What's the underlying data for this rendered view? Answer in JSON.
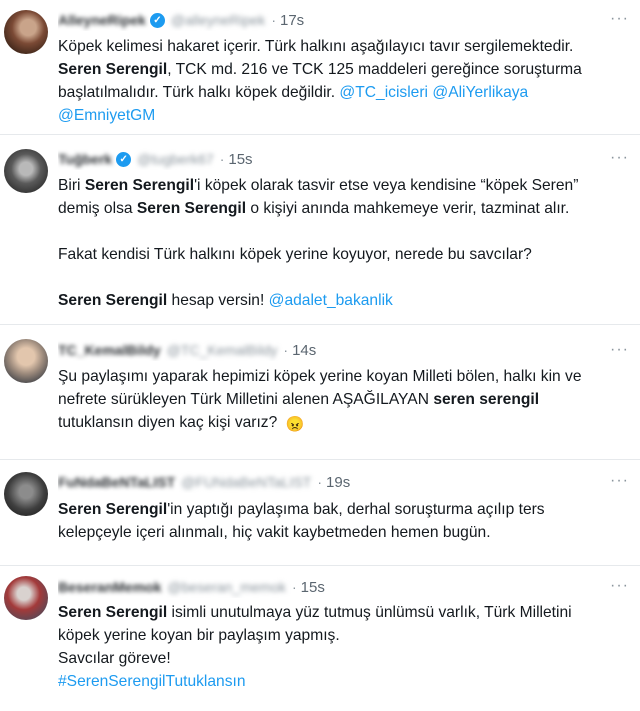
{
  "tweets": [
    {
      "name": "AlleyneRipek",
      "handle": "@alleyneRipek",
      "time": "17s",
      "verified": true,
      "lines": [
        [
          {
            "t": "Köpek kelimesi hakaret içerir. Türk halkını aşağılayıcı tavır sergilemektedir."
          }
        ],
        [
          {
            "t": "Seren Serengil",
            "b": true
          },
          {
            "t": ", TCK md. 216 ve TCK 125 maddeleri gereğince soruşturma"
          }
        ],
        [
          {
            "t": "başlatılmalıdır. Türk halkı köpek değildir. "
          },
          {
            "t": "@TC_icisleri",
            "l": true
          },
          {
            "t": " "
          },
          {
            "t": "@AliYerlikaya",
            "l": true
          }
        ],
        [
          {
            "t": "@EmniyetGM",
            "l": true
          }
        ]
      ]
    },
    {
      "name": "Tuğberk",
      "handle": "@tugberk67",
      "time": "15s",
      "verified": true,
      "lines": [
        [
          {
            "t": "Biri "
          },
          {
            "t": "Seren Serengil",
            "b": true
          },
          {
            "t": "'i köpek olarak tasvir etse veya kendisine “köpek Seren”"
          }
        ],
        [
          {
            "t": "demiş olsa "
          },
          {
            "t": "Seren Serengil",
            "b": true
          },
          {
            "t": " o kişiyi anında mahkemeye verir, tazminat alır."
          }
        ],
        [],
        [
          {
            "t": "Fakat kendisi Türk halkını köpek yerine koyuyor, nerede bu savcılar?"
          }
        ],
        [],
        [
          {
            "t": "Seren Serengil",
            "b": true
          },
          {
            "t": " hesap versin! "
          },
          {
            "t": "@adalet_bakanlik",
            "l": true
          }
        ]
      ]
    },
    {
      "name": "TC_KemalBildy",
      "handle": "@TC_KemalBildy",
      "time": "14s",
      "verified": false,
      "lines": [
        [
          {
            "t": "Şu paylaşımı yaparak hepimizi köpek yerine koyan  Milleti bölen, halkı kin ve"
          }
        ],
        [
          {
            "t": "nefrete sürükleyen Türk Milletini alenen AŞAĞILAYAN "
          },
          {
            "t": "seren serengil",
            "b": true
          }
        ],
        [
          {
            "t": "tutuklansın diyen kaç kişi varız? "
          },
          {
            "t": "😠",
            "e": true
          }
        ]
      ]
    },
    {
      "name": "FuNdaBeNTaLIST",
      "handle": "@FUNdaBeNTaLIST",
      "time": "19s",
      "verified": false,
      "lines": [
        [
          {
            "t": "Seren Serengil",
            "b": true
          },
          {
            "t": "'in yaptığı paylaşıma bak, derhal soruşturma açılıp ters"
          }
        ],
        [
          {
            "t": "kelepçeyle içeri alınmalı, hiç vakit kaybetmeden hemen bugün."
          }
        ]
      ]
    },
    {
      "name": "BeseranMemok",
      "handle": "@beseran_memok",
      "time": "15s",
      "verified": false,
      "lines": [
        [
          {
            "t": "Seren Serengil",
            "b": true
          },
          {
            "t": " isimli unutulmaya yüz tutmuş ünlümsü varlık, Türk Milletini"
          }
        ],
        [
          {
            "t": "köpek yerine koyan bir paylaşım yapmış."
          }
        ],
        [
          {
            "t": "Savcılar göreve!"
          }
        ],
        [
          {
            "t": "#SerenSerengilTutuklansın",
            "l": true
          }
        ]
      ]
    }
  ],
  "ui": {
    "more_glyph": "···",
    "dot_glyph": "·",
    "verified_glyph": "✓"
  }
}
